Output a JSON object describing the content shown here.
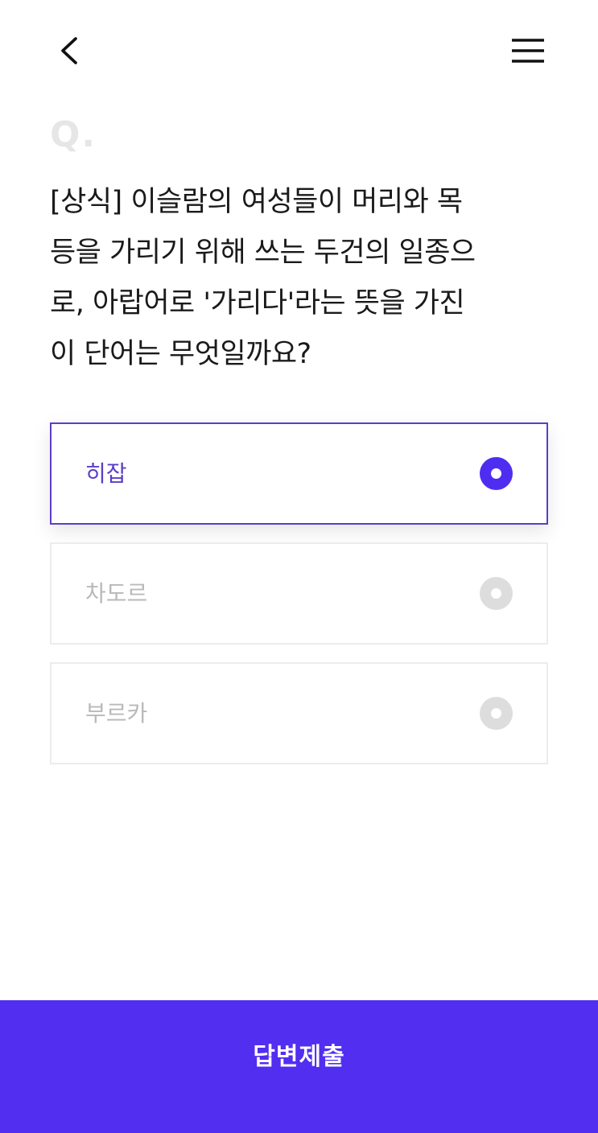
{
  "header": {
    "back_icon": "chevron-left-icon",
    "menu_icon": "hamburger-menu-icon"
  },
  "quiz": {
    "q_label": "Q.",
    "question_lines": [
      "[상식] 이슬람의 여성들이 머리와 목",
      "등을 가리기 위해 쓰는 두건의 일종으",
      "로, 아랍어로 '가리다'라는 뜻을 가진",
      "이 단어는 무엇일까요?"
    ],
    "options": [
      {
        "label": "히잡",
        "selected": true
      },
      {
        "label": "차도르",
        "selected": false
      },
      {
        "label": "부르카",
        "selected": false
      }
    ]
  },
  "footer": {
    "submit_label": "답변제출"
  },
  "colors": {
    "accent": "#512ef0",
    "selected_text": "#5b3ec8",
    "unselected_text": "#b9b9b9",
    "radio_inactive": "#dddddd"
  }
}
